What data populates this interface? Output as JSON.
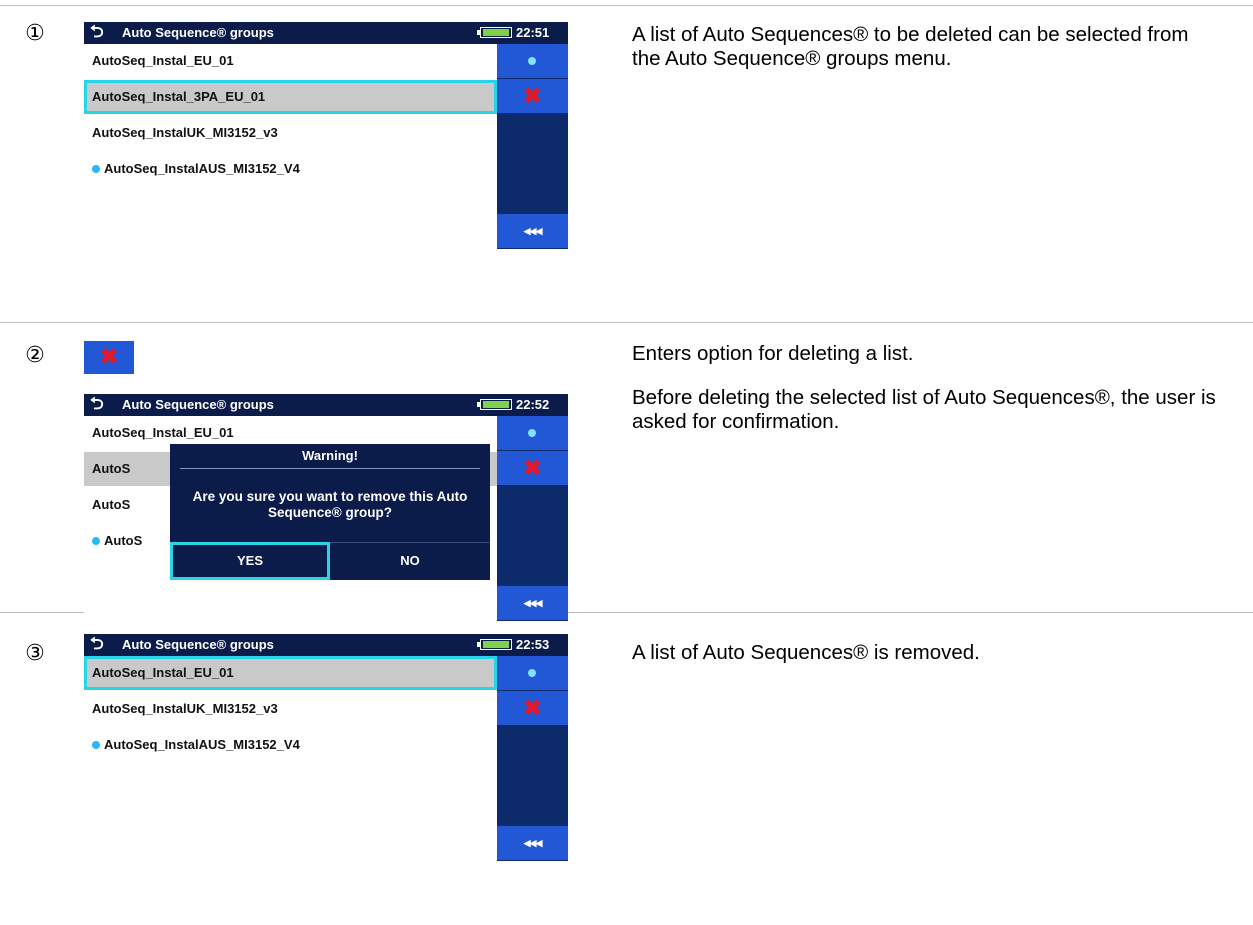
{
  "steps": [
    {
      "number": "①",
      "desc": [
        "A list of Auto Sequences® to be deleted can be selected from the Auto Sequence® groups menu."
      ],
      "screen": {
        "title": "Auto Sequence® groups",
        "time": "22:51",
        "battery_level": 1.0,
        "rows": [
          {
            "label": "AutoSeq_Instal_EU_01",
            "selected": false,
            "dot": false
          },
          {
            "label": "AutoSeq_Instal_3PA_EU_01",
            "selected": true,
            "dot": false
          },
          {
            "label": "AutoSeq_InstalUK_MI3152_v3",
            "selected": false,
            "dot": false
          },
          {
            "label": "AutoSeq_InstalAUS_MI3152_V4",
            "selected": false,
            "dot": true
          }
        ]
      }
    },
    {
      "number": "②",
      "desc": [
        "Enters option for deleting a list.",
        "Before deleting the selected list of Auto Sequences®, the user is asked for confirmation."
      ],
      "screen": {
        "title": "Auto Sequence® groups",
        "time": "22:52",
        "battery_level": 1.0,
        "rows": [
          {
            "label": "AutoSeq_Instal_EU_01",
            "selected": false,
            "dot": false
          },
          {
            "label": "AutoS",
            "selected": false,
            "dot": false,
            "highlight": true
          },
          {
            "label": "AutoS",
            "selected": false,
            "dot": false
          },
          {
            "label": "AutoS",
            "selected": false,
            "dot": true
          }
        ],
        "dialog": {
          "title": "Warning!",
          "message": "Are you sure you want to remove this Auto Sequence® group?",
          "yes": "YES",
          "no": "NO"
        }
      }
    },
    {
      "number": "③",
      "desc": [
        "A list of Auto Sequences® is removed."
      ],
      "screen": {
        "title": "Auto Sequence® groups",
        "time": "22:53",
        "battery_level": 1.0,
        "rows": [
          {
            "label": "AutoSeq_Instal_EU_01",
            "selected": true,
            "dot": false
          },
          {
            "label": "AutoSeq_InstalUK_MI3152_v3",
            "selected": false,
            "dot": false
          },
          {
            "label": "AutoSeq_InstalAUS_MI3152_V4",
            "selected": false,
            "dot": true
          }
        ]
      }
    }
  ],
  "side_buttons": {
    "delete_symbol": "✖",
    "back_symbol": "◀◀◀",
    "back_arrow_symbol": "⮌"
  },
  "colors": {
    "header_bg": "#0b1b4a",
    "selection_outline": "#27d4e8",
    "side_button": "#2257d6",
    "delete_red": "#e0192b",
    "dot_blue": "#29b6f6"
  }
}
